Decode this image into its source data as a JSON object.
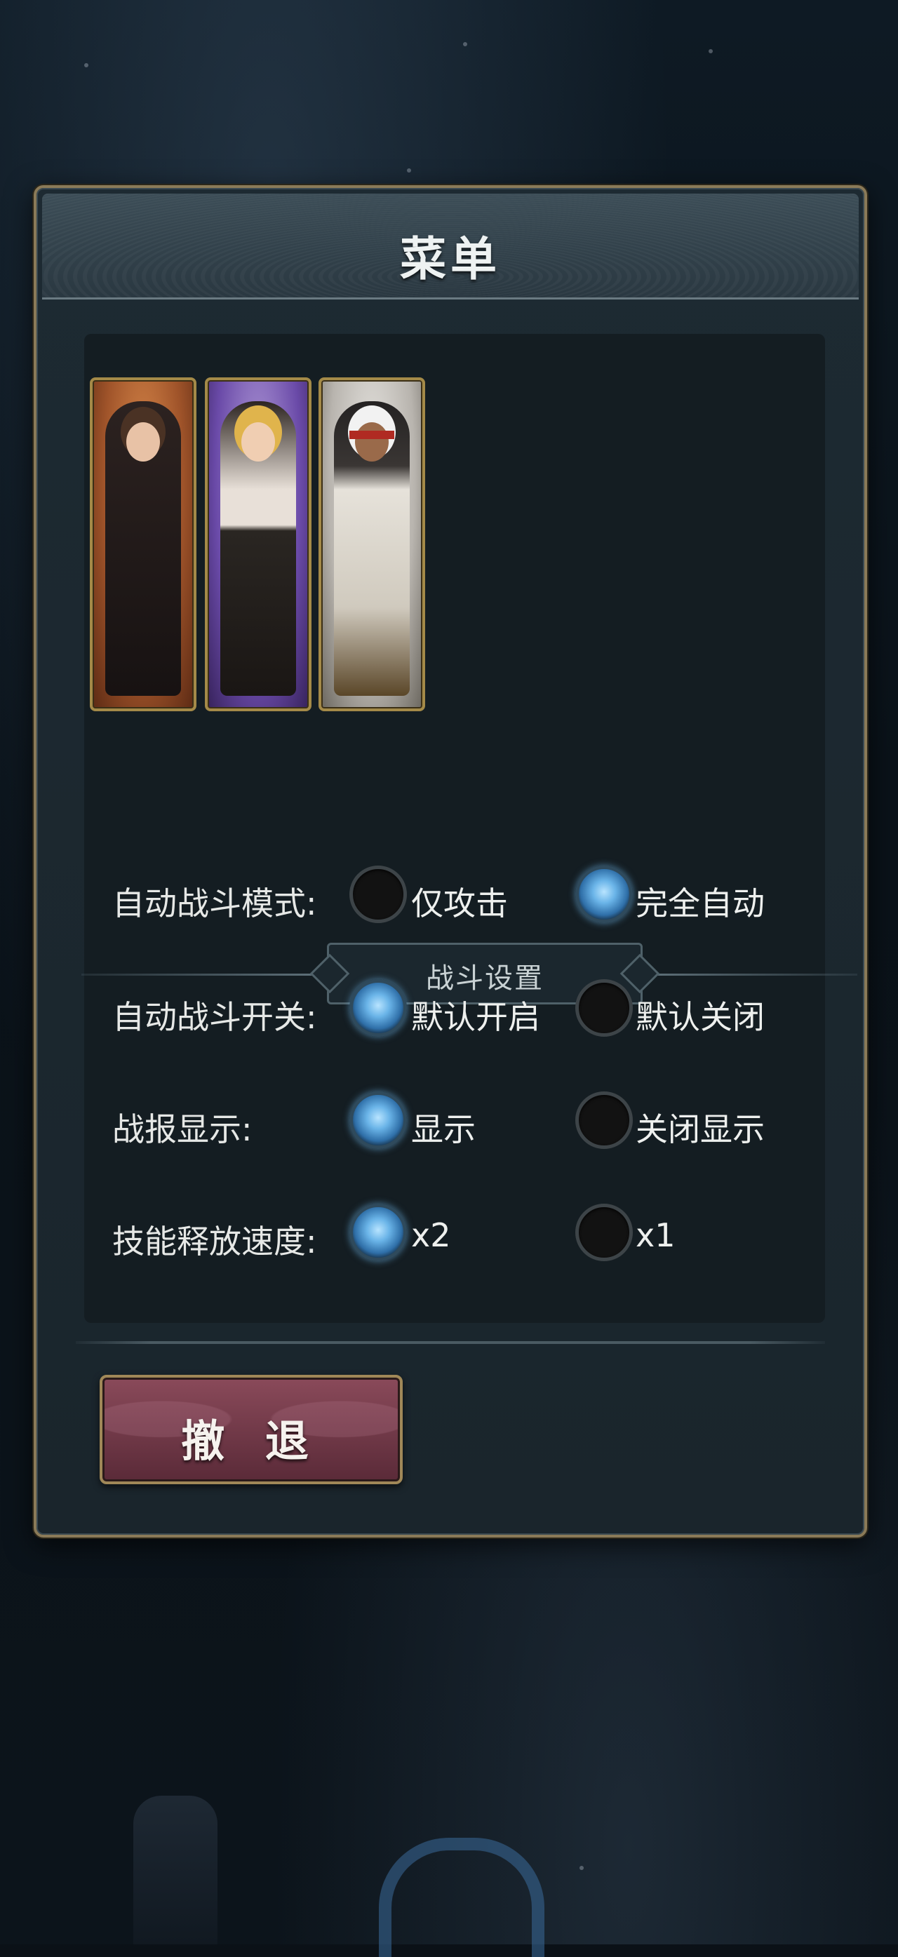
{
  "menu": {
    "title": "菜单"
  },
  "party": {
    "cards": [
      {
        "name": "brown-haired-woman"
      },
      {
        "name": "blonde-woman"
      },
      {
        "name": "white-haired-man"
      }
    ]
  },
  "battle_settings": {
    "section_title": "战斗设置",
    "rows": [
      {
        "label": "自动战斗模式:",
        "option_a": "仅攻击",
        "option_b": "完全自动",
        "selected": "option_b"
      },
      {
        "label": "自动战斗开关:",
        "option_a": "默认开启",
        "option_b": "默认关闭",
        "selected": "option_a"
      },
      {
        "label": "战报显示:",
        "option_a": "显示",
        "option_b": "关闭显示",
        "selected": "option_a"
      },
      {
        "label": "技能释放速度:",
        "option_a": "x2",
        "option_b": "x1",
        "selected": "option_a"
      }
    ]
  },
  "actions": {
    "retreat_label": "撤 退"
  },
  "colors": {
    "panel_border": "#8a7a58",
    "radio_selected": "#6ab4e8",
    "retreat_button": "#7a3e4e"
  }
}
